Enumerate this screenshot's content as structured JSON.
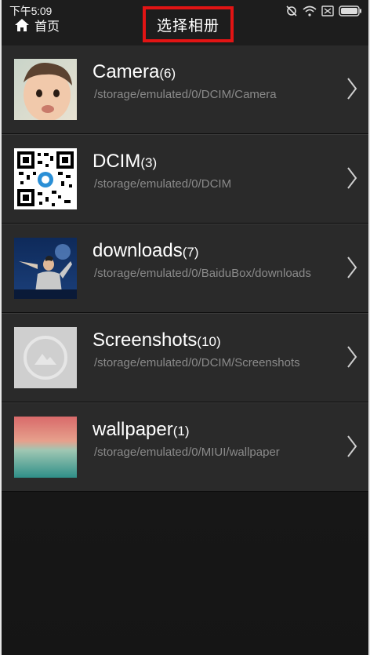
{
  "status_bar": {
    "time": "下午5:09"
  },
  "header": {
    "back_label": "首页",
    "title": "选择相册"
  },
  "albums": [
    {
      "name": "Camera",
      "count": "(6)",
      "path": "/storage/emulated/0/DCIM/Camera"
    },
    {
      "name": "DCIM",
      "count": "(3)",
      "path": "/storage/emulated/0/DCIM"
    },
    {
      "name": "downloads",
      "count": "(7)",
      "path": "/storage/emulated/0/BaiduBox/downloads"
    },
    {
      "name": "Screenshots",
      "count": "(10)",
      "path": "/storage/emulated/0/DCIM/Screenshots"
    },
    {
      "name": "wallpaper",
      "count": "(1)",
      "path": "/storage/emulated/0/MIUI/wallpaper"
    }
  ],
  "colors": {
    "highlight": "#e21414",
    "row_bg": "#2a2a2a",
    "path_text": "#8a8a8a"
  }
}
